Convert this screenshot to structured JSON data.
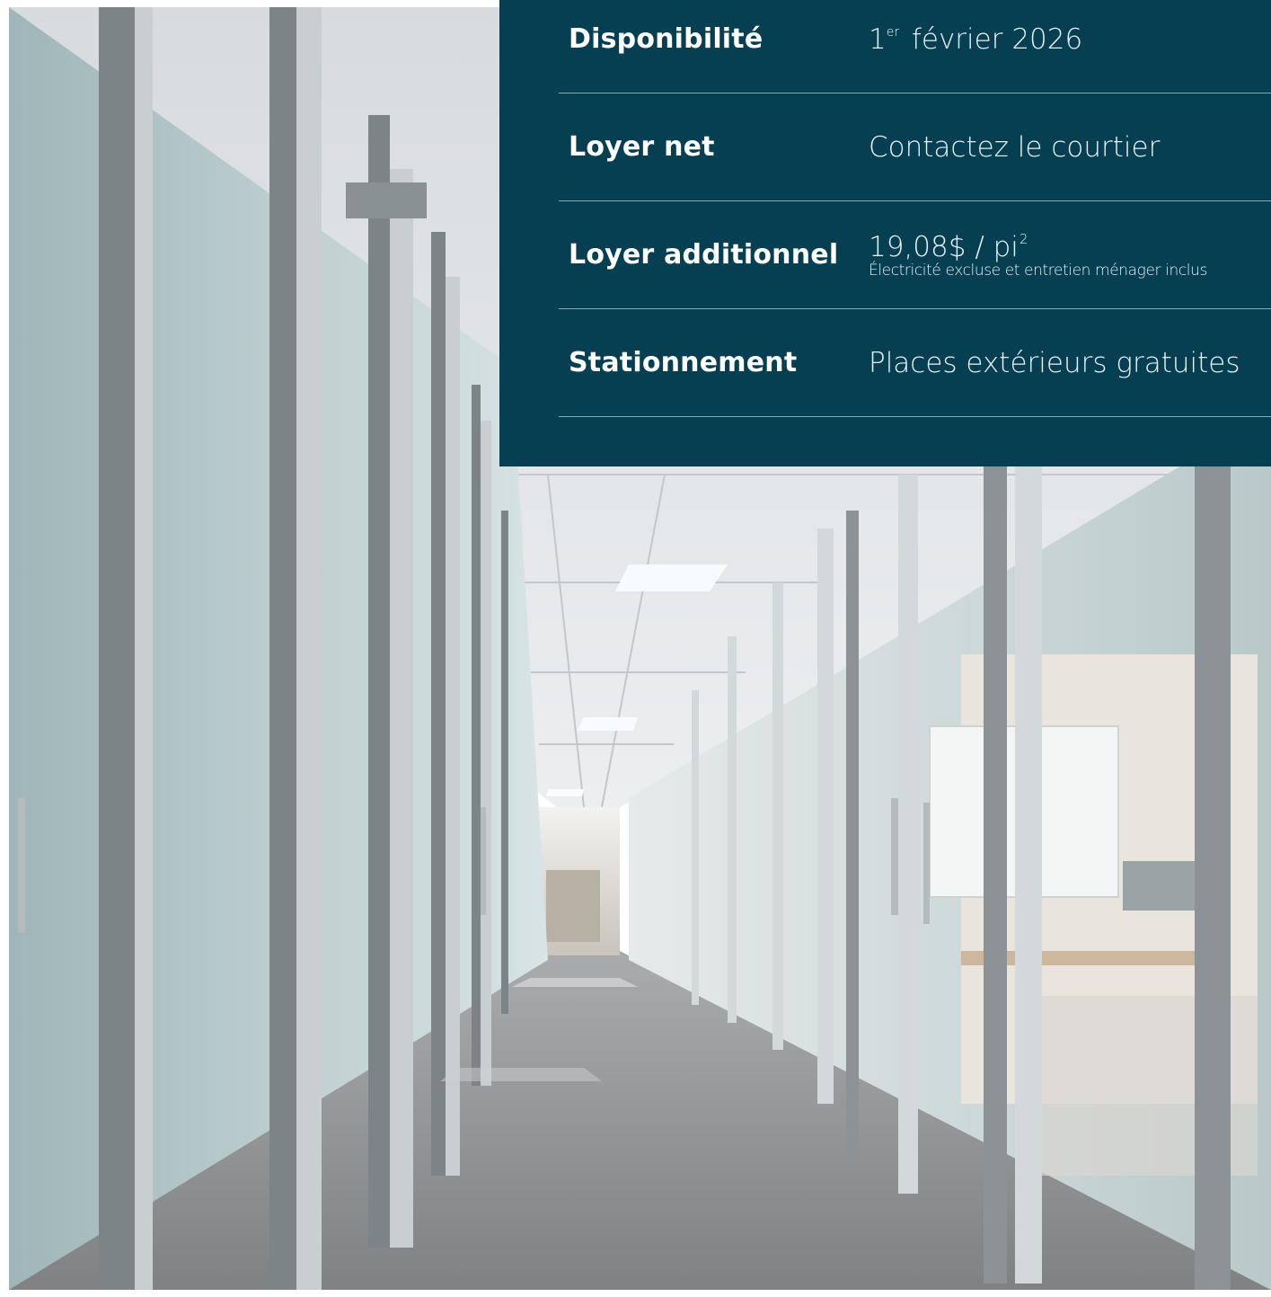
{
  "photo": {
    "description_icon": "office-corridor-photo"
  },
  "details": {
    "rows": [
      {
        "label": "Disponibilité",
        "value_pre": "1",
        "value_sup": "er",
        "value_post": " février 2026"
      },
      {
        "label": "Loyer net",
        "value": "Contactez le courtier"
      },
      {
        "label": "Loyer additionnel",
        "value_pre": "19,08$ / pi",
        "value_sup": "2",
        "note": "Électricité excluse et entretien ménager inclus"
      },
      {
        "label": "Stationnement",
        "value": "Places extérieurs gratuites"
      }
    ]
  },
  "colors": {
    "panel": "#073f52",
    "text": "#ffffff"
  }
}
